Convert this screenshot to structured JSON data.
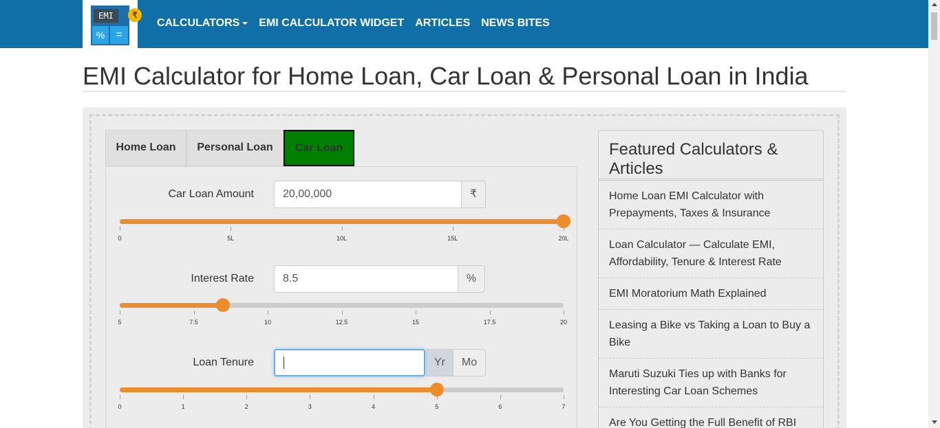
{
  "navbar": {
    "logo": {
      "screen_text": "EMI",
      "key_left": "%",
      "key_right": "=",
      "badge": "₹"
    },
    "items": [
      {
        "label": "CALCULATORS",
        "has_dropdown": true
      },
      {
        "label": "EMI CALCULATOR WIDGET",
        "has_dropdown": false
      },
      {
        "label": "ARTICLES",
        "has_dropdown": false
      },
      {
        "label": "NEWS BITES",
        "has_dropdown": false
      }
    ]
  },
  "page": {
    "title": "EMI Calculator for Home Loan, Car Loan & Personal Loan in India"
  },
  "tabs": [
    {
      "label": "Home Loan",
      "active": false
    },
    {
      "label": "Personal Loan",
      "active": false
    },
    {
      "label": "Car Loan",
      "active": true
    }
  ],
  "form": {
    "loan_amount": {
      "label": "Car Loan Amount",
      "value": "20,00,000",
      "addon": "₹",
      "slider_fraction": 1.0,
      "ticks": [
        "0",
        "5L",
        "10L",
        "15L",
        "20L"
      ]
    },
    "interest_rate": {
      "label": "Interest Rate",
      "value": "8.5",
      "addon": "%",
      "slider_fraction": 0.233,
      "ticks": [
        "5",
        "7.5",
        "10",
        "12.5",
        "15",
        "17.5",
        "20"
      ]
    },
    "loan_tenure": {
      "label": "Loan Tenure",
      "value": "",
      "unit_year": "Yr",
      "unit_month": "Mo",
      "selected_unit": "Yr",
      "slider_fraction": 0.714,
      "ticks": [
        "0",
        "1",
        "2",
        "3",
        "4",
        "5",
        "6",
        "7"
      ]
    }
  },
  "sidebar": {
    "heading": "Featured Calculators & Articles",
    "links": [
      "Home Loan EMI Calculator with Prepayments, Taxes & Insurance",
      "Loan Calculator — Calculate EMI, Affordability, Tenure & Interest Rate",
      "EMI Moratorium Math Explained",
      "Leasing a Bike vs Taking a Loan to Buy a Bike",
      "Maruti Suzuki Ties up with Banks for Interesting Car Loan Schemes",
      "Are You Getting the Full Benefit of RBI"
    ]
  },
  "colors": {
    "navbar": "#0f6fa6",
    "slider": "#ed8c2b",
    "active_tab": "#008000"
  }
}
